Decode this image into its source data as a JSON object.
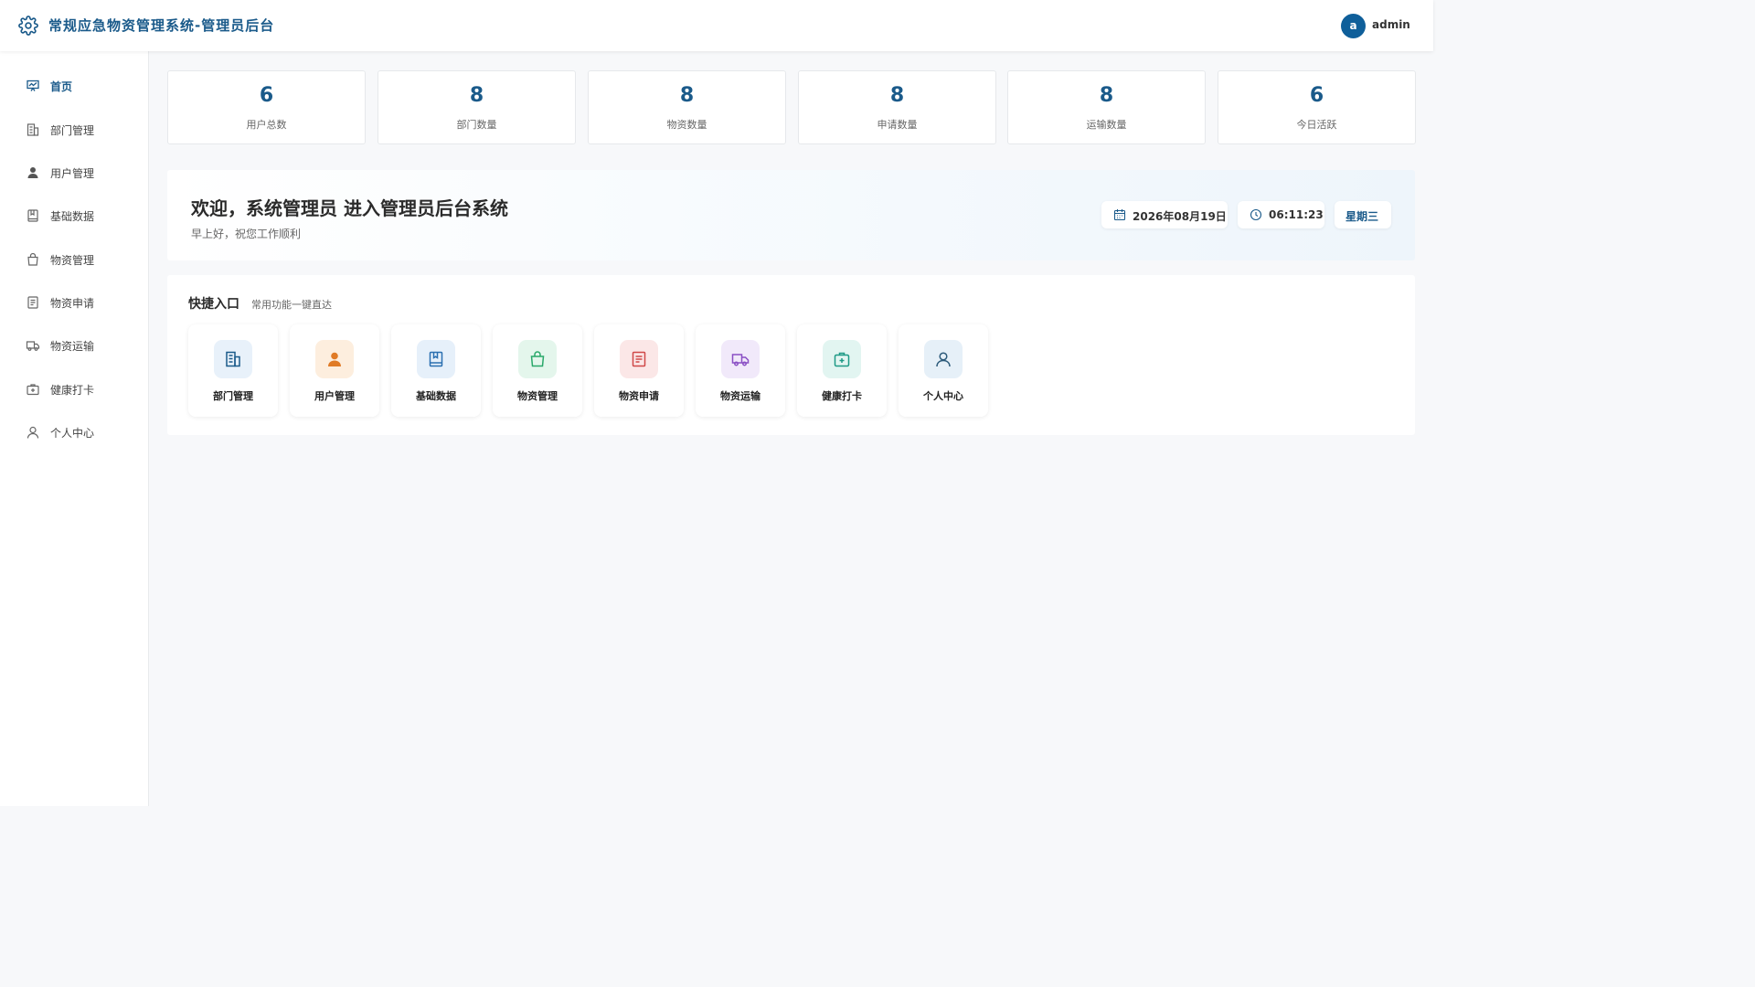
{
  "header": {
    "title": "常规应急物资管理系统-管理员后台",
    "avatar_initial": "a",
    "username": "admin"
  },
  "sidebar": {
    "items": [
      {
        "label": "首页",
        "icon": "dashboard-icon",
        "active": true
      },
      {
        "label": "部门管理",
        "icon": "building-icon",
        "active": false
      },
      {
        "label": "用户管理",
        "icon": "user-icon",
        "active": false
      },
      {
        "label": "基础数据",
        "icon": "book-icon",
        "active": false
      },
      {
        "label": "物资管理",
        "icon": "bag-icon",
        "active": false
      },
      {
        "label": "物资申请",
        "icon": "document-icon",
        "active": false
      },
      {
        "label": "物资运输",
        "icon": "truck-icon",
        "active": false
      },
      {
        "label": "健康打卡",
        "icon": "medical-kit-icon",
        "active": false
      },
      {
        "label": "个人中心",
        "icon": "person-icon",
        "active": false
      }
    ]
  },
  "stats": [
    {
      "value": "6",
      "label": "用户总数"
    },
    {
      "value": "8",
      "label": "部门数量"
    },
    {
      "value": "8",
      "label": "物资数量"
    },
    {
      "value": "8",
      "label": "申请数量"
    },
    {
      "value": "8",
      "label": "运输数量"
    },
    {
      "value": "6",
      "label": "今日活跃"
    }
  ],
  "welcome": {
    "title": "欢迎，系统管理员 进入管理员后台系统",
    "subtitle": "早上好，祝您工作顺利",
    "date": "2026年08月19日",
    "time": "06:11:23",
    "weekday": "星期三"
  },
  "quick": {
    "title": "快捷入口",
    "subtitle": "常用功能一键直达",
    "items": [
      {
        "label": "部门管理",
        "icon": "building-icon",
        "color": "#1a5a8a",
        "bg": "#e8f1fa"
      },
      {
        "label": "用户管理",
        "icon": "user-icon",
        "color": "#e07b26",
        "bg": "#fdeede"
      },
      {
        "label": "基础数据",
        "icon": "book-icon",
        "color": "#2a6fb0",
        "bg": "#e6f0fa"
      },
      {
        "label": "物资管理",
        "icon": "bag-icon",
        "color": "#2aa86a",
        "bg": "#e4f6ec"
      },
      {
        "label": "物资申请",
        "icon": "document-icon",
        "color": "#d04848",
        "bg": "#fbe7e7"
      },
      {
        "label": "物资运输",
        "icon": "truck-icon",
        "color": "#8a4fc4",
        "bg": "#f1e9fa"
      },
      {
        "label": "健康打卡",
        "icon": "medical-kit-icon",
        "color": "#1e9a86",
        "bg": "#e2f5f1"
      },
      {
        "label": "个人中心",
        "icon": "person-icon",
        "color": "#2c5a7a",
        "bg": "#e6f0f8"
      }
    ]
  }
}
